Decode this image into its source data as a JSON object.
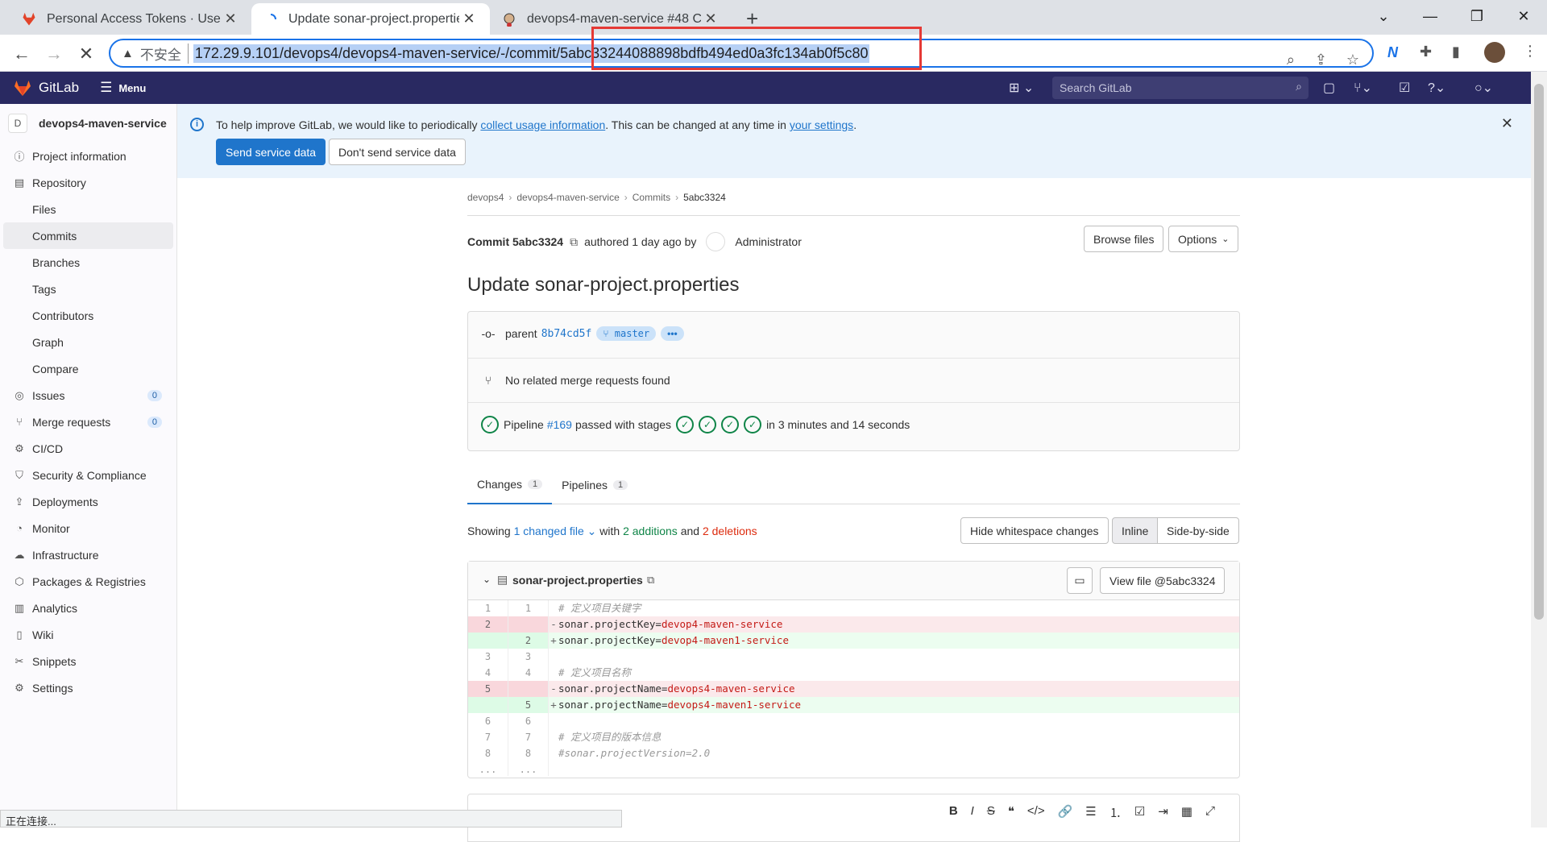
{
  "browser": {
    "tabs": [
      {
        "title": "Personal Access Tokens · User",
        "close": "✕"
      },
      {
        "title": "Update sonar-project.propertie",
        "close": "✕"
      },
      {
        "title": "devops4-maven-service #48 C",
        "close": "✕"
      }
    ],
    "new_tab": "+",
    "insecure_label": "不安全",
    "url": "172.29.9.101/devops4/devops4-maven-service/-/commit/5abc33244088898bdfb494ed0a3fc134ab0f5c80",
    "status_text": "正在连接..."
  },
  "topbar": {
    "brand": "GitLab",
    "menu_label": "Menu",
    "search_placeholder": "Search GitLab"
  },
  "sidebar": {
    "project_avatar": "D",
    "project_name": "devops4-maven-service",
    "items": [
      {
        "label": "Project information",
        "icon": "info-icon"
      },
      {
        "label": "Repository",
        "icon": "book-icon"
      },
      {
        "label": "Files"
      },
      {
        "label": "Commits"
      },
      {
        "label": "Branches"
      },
      {
        "label": "Tags"
      },
      {
        "label": "Contributors"
      },
      {
        "label": "Graph"
      },
      {
        "label": "Compare"
      },
      {
        "label": "Issues",
        "badge": "0"
      },
      {
        "label": "Merge requests",
        "badge": "0"
      },
      {
        "label": "CI/CD"
      },
      {
        "label": "Security & Compliance"
      },
      {
        "label": "Deployments"
      },
      {
        "label": "Monitor"
      },
      {
        "label": "Infrastructure"
      },
      {
        "label": "Packages & Registries"
      },
      {
        "label": "Analytics"
      },
      {
        "label": "Wiki"
      },
      {
        "label": "Snippets"
      },
      {
        "label": "Settings"
      }
    ]
  },
  "banner": {
    "text_before": "To help improve GitLab, we would like to periodically ",
    "link1": "collect usage information",
    "text_middle": ". This can be changed at any time in ",
    "link2": "your settings",
    "text_after": ".",
    "send_button": "Send service data",
    "dont_button": "Don't send service data"
  },
  "breadcrumb": [
    "devops4",
    "devops4-maven-service",
    "Commits",
    "5abc3324"
  ],
  "commit": {
    "label": "Commit 5abc3324",
    "authored": "authored 1 day ago by",
    "author": "Administrator",
    "browse_files": "Browse files",
    "options": "Options",
    "title": "Update sonar-project.properties",
    "parent_label": "parent",
    "parent_sha": "8b74cd5f",
    "branch": "master",
    "more": "•••",
    "no_mr": "No related merge requests found",
    "pipeline_label": "Pipeline",
    "pipeline_id": "#169",
    "pipeline_status": "passed with stages",
    "pipeline_duration": "in 3 minutes and 14 seconds"
  },
  "tabs": [
    {
      "label": "Changes",
      "count": "1"
    },
    {
      "label": "Pipelines",
      "count": "1"
    }
  ],
  "summary": {
    "showing": "Showing",
    "changed_files": "1 changed file",
    "with": "with",
    "additions": "2 additions",
    "and": "and",
    "deletions": "2 deletions",
    "hide_whitespace": "Hide whitespace changes",
    "inline": "Inline",
    "side_by_side": "Side-by-side"
  },
  "diff": {
    "filename": "sonar-project.properties",
    "view_file": "View file @5abc3324",
    "lines": [
      {
        "type": "ctx",
        "old": "1",
        "new": "1",
        "key": "# 定义项目关键字",
        "val": ""
      },
      {
        "type": "old",
        "old": "2",
        "new": "",
        "key": "sonar.projectKey=",
        "val": "devop4-maven-service"
      },
      {
        "type": "new",
        "old": "",
        "new": "2",
        "key": "sonar.projectKey=",
        "val": "devop4-maven1-service"
      },
      {
        "type": "ctx",
        "old": "3",
        "new": "3",
        "key": "",
        "val": ""
      },
      {
        "type": "ctx",
        "old": "4",
        "new": "4",
        "key": "# 定义项目名称",
        "val": ""
      },
      {
        "type": "old",
        "old": "5",
        "new": "",
        "key": "sonar.projectName=",
        "val": "devops4-maven-service"
      },
      {
        "type": "new",
        "old": "",
        "new": "5",
        "key": "sonar.projectName=",
        "val": "devops4-maven1-service"
      },
      {
        "type": "ctx",
        "old": "6",
        "new": "6",
        "key": "",
        "val": ""
      },
      {
        "type": "ctx",
        "old": "7",
        "new": "7",
        "key": "# 定义项目的版本信息",
        "val": ""
      },
      {
        "type": "ctx",
        "old": "8",
        "new": "8",
        "key": "#sonar.projectVersion=2.0",
        "val": ""
      },
      {
        "type": "ctx",
        "old": "...",
        "new": "...",
        "key": "",
        "val": ""
      }
    ]
  },
  "colors": {
    "topbar": "#292961",
    "link": "#1f75cb",
    "success": "#108548",
    "danger": "#dd2b0e"
  }
}
